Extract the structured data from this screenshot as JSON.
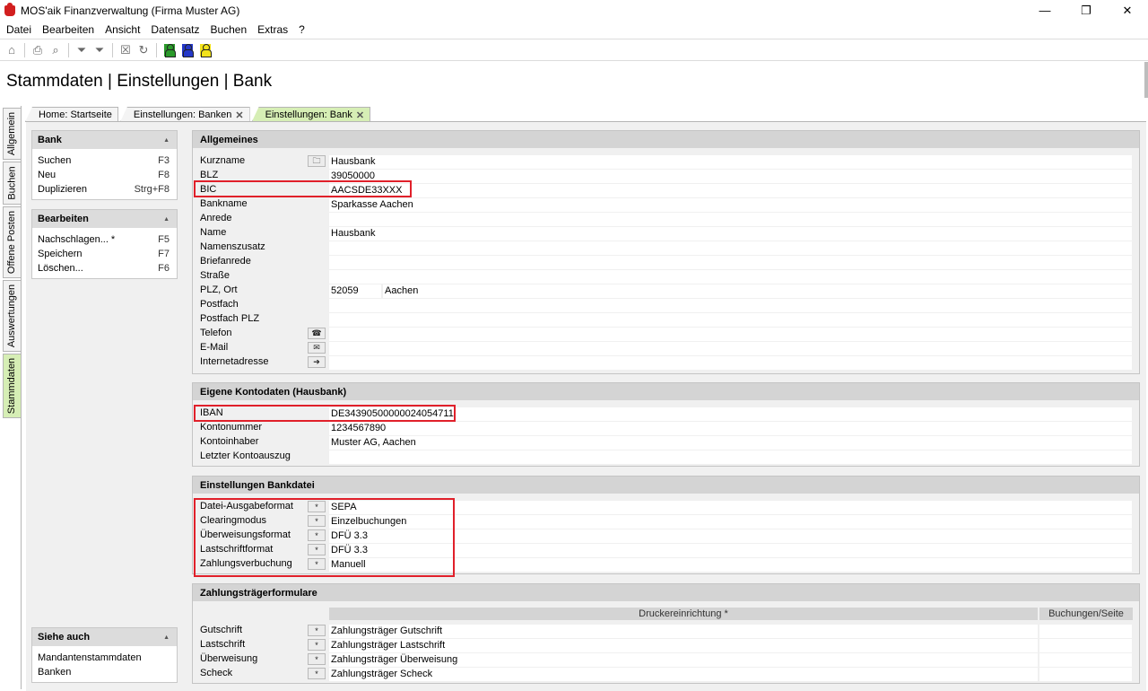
{
  "window": {
    "title": "MOS'aik Finanzverwaltung (Firma Muster AG)",
    "min": "—",
    "max": "❐",
    "close": "✕"
  },
  "menu": [
    "Datei",
    "Bearbeiten",
    "Ansicht",
    "Datensatz",
    "Buchen",
    "Extras",
    "?"
  ],
  "page_title": "Stammdaten | Einstellungen | Bank",
  "vtabs": [
    "Allgemein",
    "Buchen",
    "Offene Posten",
    "Auswertungen",
    "Stammdaten"
  ],
  "tabs": [
    "Home: Startseite",
    "Einstellungen: Banken",
    "Einstellungen: Bank"
  ],
  "tab_close": "✕",
  "left": {
    "bank": {
      "title": "Bank",
      "items": [
        {
          "label": "Suchen",
          "key": "F3"
        },
        {
          "label": "Neu",
          "key": "F8"
        },
        {
          "label": "Duplizieren",
          "key": "Strg+F8"
        }
      ]
    },
    "bearbeiten": {
      "title": "Bearbeiten",
      "items": [
        {
          "label": "Nachschlagen... *",
          "key": "F5"
        },
        {
          "label": "Speichern",
          "key": "F7"
        },
        {
          "label": "Löschen...",
          "key": "F6"
        }
      ]
    },
    "siehe": {
      "title": "Siehe auch",
      "items": [
        "Mandantenstammdaten",
        "Banken"
      ]
    }
  },
  "allgemeines": {
    "title": "Allgemeines",
    "kurzname": {
      "label": "Kurzname",
      "value": "Hausbank"
    },
    "blz": {
      "label": "BLZ",
      "value": "39050000"
    },
    "bic": {
      "label": "BIC",
      "value": "AACSDE33XXX"
    },
    "bankname": {
      "label": "Bankname",
      "value": "Sparkasse Aachen"
    },
    "anrede": {
      "label": "Anrede",
      "value": ""
    },
    "name": {
      "label": "Name",
      "value": "Hausbank"
    },
    "namenszusatz": {
      "label": "Namenszusatz",
      "value": ""
    },
    "briefanrede": {
      "label": "Briefanrede",
      "value": ""
    },
    "strasse": {
      "label": "Straße",
      "value": ""
    },
    "plzort": {
      "label": "PLZ, Ort",
      "plz": "52059",
      "ort": "Aachen"
    },
    "postfach": {
      "label": "Postfach",
      "value": ""
    },
    "postfachplz": {
      "label": "Postfach PLZ",
      "value": ""
    },
    "telefon": {
      "label": "Telefon",
      "value": ""
    },
    "email": {
      "label": "E-Mail",
      "value": ""
    },
    "internet": {
      "label": "Internetadresse",
      "value": ""
    }
  },
  "konto": {
    "title": "Eigene Kontodaten (Hausbank)",
    "iban": {
      "label": "IBAN",
      "value": "DE34390500000024054711"
    },
    "kontonummer": {
      "label": "Kontonummer",
      "value": "1234567890"
    },
    "inhaber": {
      "label": "Kontoinhaber",
      "value": "Muster AG, Aachen"
    },
    "auszug": {
      "label": "Letzter Kontoauszug",
      "value": ""
    }
  },
  "bankdatei": {
    "title": "Einstellungen Bankdatei",
    "ausgabe": {
      "label": "Datei-Ausgabeformat",
      "value": "SEPA"
    },
    "clearing": {
      "label": "Clearingmodus",
      "value": "Einzelbuchungen"
    },
    "ueberweisung": {
      "label": "Überweisungsformat",
      "value": "DFÜ 3.3"
    },
    "lastschrift": {
      "label": "Lastschriftformat",
      "value": "DFÜ 3.3"
    },
    "verbuchung": {
      "label": "Zahlungsverbuchung",
      "value": "Manuell"
    }
  },
  "formulare": {
    "title": "Zahlungsträgerformulare",
    "col1": "Druckereinrichtung *",
    "col2": "Buchungen/Seite",
    "gutschrift": {
      "label": "Gutschrift",
      "value": "Zahlungsträger Gutschrift"
    },
    "lastschrift": {
      "label": "Lastschrift",
      "value": "Zahlungsträger Lastschrift"
    },
    "ueberweisung": {
      "label": "Überweisung",
      "value": "Zahlungsträger Überweisung"
    },
    "scheck": {
      "label": "Scheck",
      "value": "Zahlungsträger Scheck"
    }
  },
  "lookup_btn": "*",
  "colors": {
    "accent_green": "#d6eeb5",
    "highlight_red": "#e0202a"
  }
}
